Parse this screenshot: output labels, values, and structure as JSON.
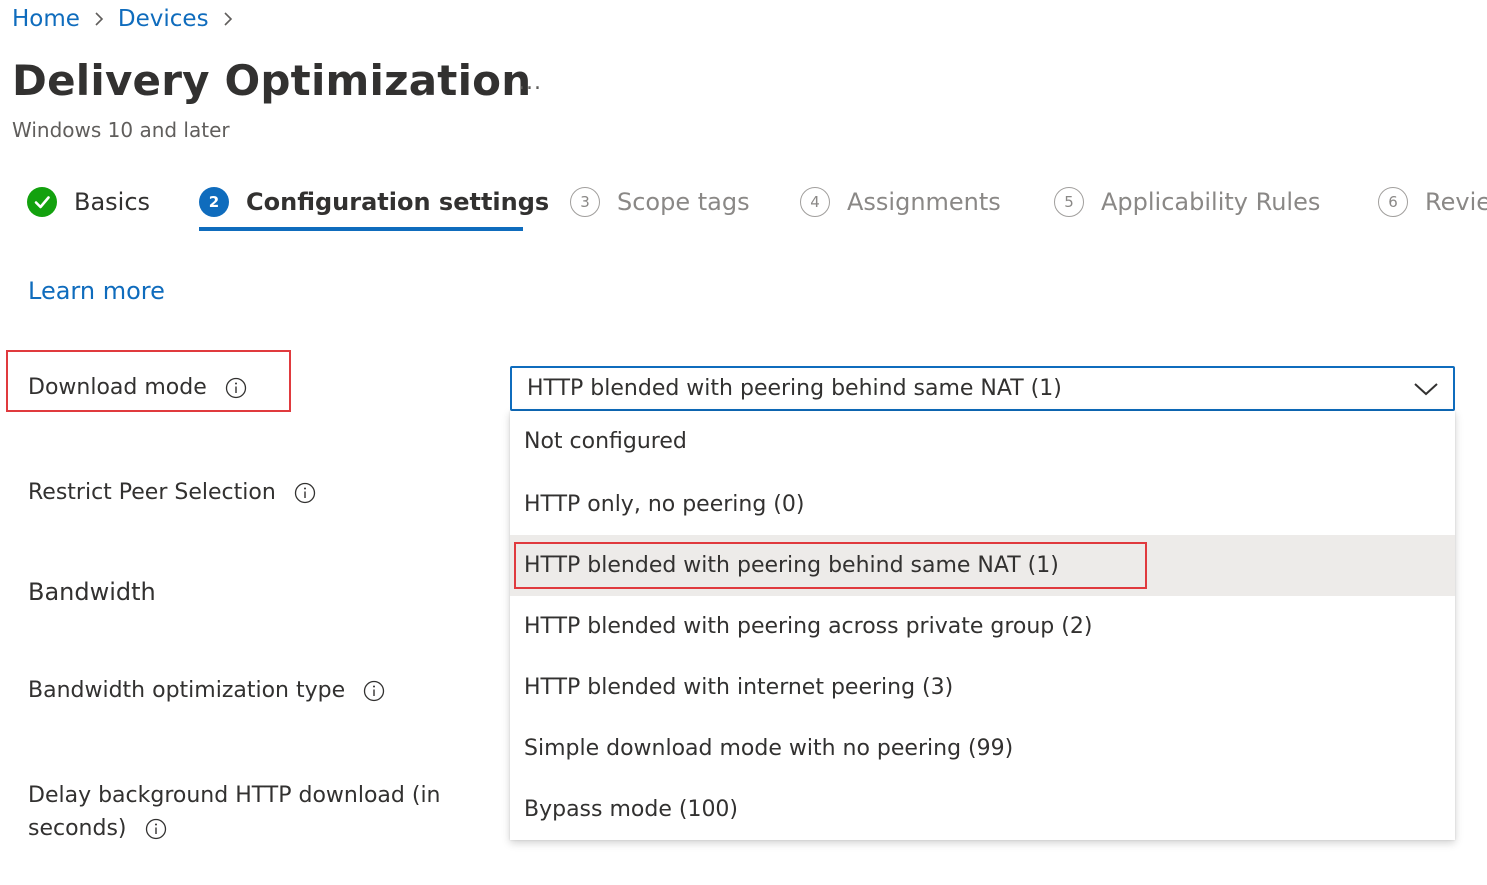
{
  "breadcrumb": {
    "items": [
      "Home",
      "Devices"
    ]
  },
  "header": {
    "title": "Delivery Optimization",
    "more": "...",
    "subtitle": "Windows 10 and later"
  },
  "steps": [
    {
      "label": "Basics",
      "number": "",
      "state": "done"
    },
    {
      "label": "Configuration settings",
      "number": "2",
      "state": "active"
    },
    {
      "label": "Scope tags",
      "number": "3",
      "state": "pending"
    },
    {
      "label": "Assignments",
      "number": "4",
      "state": "pending"
    },
    {
      "label": "Applicability Rules",
      "number": "5",
      "state": "pending"
    },
    {
      "label": "Revie",
      "number": "6",
      "state": "pending"
    }
  ],
  "learn_more": "Learn more",
  "fields": {
    "download_mode": "Download mode",
    "restrict_peer_selection": "Restrict Peer Selection",
    "bandwidth": "Bandwidth",
    "bandwidth_optimization_type": "Bandwidth optimization type",
    "delay_background_line1": "Delay background HTTP download (in",
    "delay_background_line2": "seconds)"
  },
  "dropdown": {
    "selected_value": "HTTP blended with peering behind same NAT (1)",
    "options": [
      "Not configured",
      "HTTP only, no peering (0)",
      "HTTP blended with peering behind same NAT (1)",
      "HTTP blended with peering across private group (2)",
      "HTTP blended with internet peering (3)",
      "Simple download mode with no peering (99)",
      "Bypass mode (100)"
    ],
    "selected_index": 2
  },
  "colors": {
    "accent": "#0f6cbd",
    "success": "#13a10e",
    "highlight": "#e03a3e",
    "selected_option_bg": "#edebe9"
  }
}
